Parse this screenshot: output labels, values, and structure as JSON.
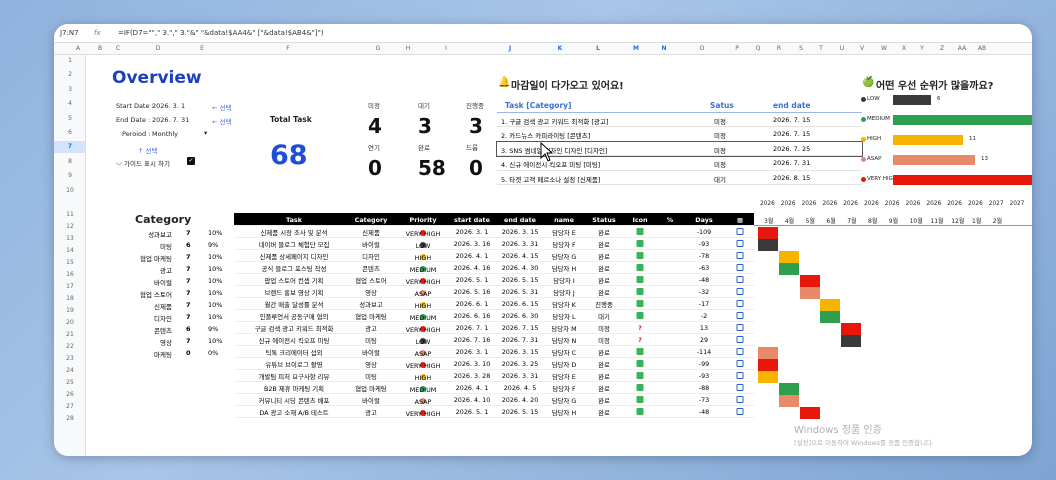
{
  "formula_bar": {
    "cell": "J7:N7",
    "fx": "fx",
    "formula": "=IF(D7=\"\",\"  3.\",\"  3.\"&\" \"&data!$AA4&\"  [\"&data!$AB4&\"]\")"
  },
  "columns": [
    "A",
    "B",
    "C",
    "D",
    "E",
    "F",
    "G",
    "H",
    "I",
    "J",
    "K",
    "L",
    "M",
    "N",
    "O",
    "P",
    "Q",
    "R",
    "S",
    "T",
    "U",
    "V",
    "W",
    "X",
    "Y",
    "Z",
    "AA",
    "AB"
  ],
  "rows": [
    "1",
    "2",
    "3",
    "4",
    "5",
    "6",
    "7",
    "8",
    "9",
    "10",
    "11",
    "12",
    "13",
    "14",
    "15",
    "16",
    "17",
    "18",
    "19",
    "20",
    "21",
    "22",
    "23",
    "24",
    "25",
    "26",
    "27",
    "28"
  ],
  "overview": {
    "title": "Overview",
    "start_label": "Start Date :",
    "start_value": "2026. 3. 1",
    "end_label": "End Date :",
    "end_value": "2026. 7. 31",
    "period_label": "Peroiod :",
    "period_value": "Monthly",
    "select_hint": "← 선택",
    "select_hint2": "← 선택",
    "select_hint3": "↑ 선택",
    "guide_label": "가이드 표시 하기",
    "total_label": "Total Task",
    "total_value": "68"
  },
  "stats": [
    {
      "label": "미정",
      "value": "4"
    },
    {
      "label": "대기",
      "value": "3"
    },
    {
      "label": "진행중",
      "value": "3"
    },
    {
      "label": "연기",
      "value": "0"
    },
    {
      "label": "완료",
      "value": "58"
    },
    {
      "label": "드롭",
      "value": "0"
    }
  ],
  "deadline": {
    "title": "마감일이 다가오고 있어요!",
    "headers": {
      "task": "Task [Category]",
      "status": "Satus",
      "end": "end date"
    },
    "rows": [
      {
        "task": "1. 구글 검색 광고 키워드 최적화 [광고]",
        "status": "미정",
        "end": "2026. 7. 15"
      },
      {
        "task": "2. 카드뉴스 카피라이팅 [콘텐츠]",
        "status": "미정",
        "end": "2026. 7. 15"
      },
      {
        "task": "3. SNS 썸네일 디자인 디자인 [디자인]",
        "status": "미정",
        "end": "2026. 7. 25"
      },
      {
        "task": "4. 신규 에이전시 킥오프 미팅 [미팅]",
        "status": "미정",
        "end": "2026. 7. 31"
      },
      {
        "task": "5. 타겟 고객 페르소나 설정 [신제품]",
        "status": "대기",
        "end": "2026. 8. 15"
      }
    ]
  },
  "priority": {
    "title": "어떤 우선 순위가 많을까요?",
    "rows": [
      {
        "label": "LOW",
        "value": "6",
        "count": 6,
        "color": "#3a3a3a",
        "dot": "#3a3a3a"
      },
      {
        "label": "MEDIUM",
        "value": "",
        "count": 25,
        "color": "#2e9e4f",
        "dot": "#2e9e4f"
      },
      {
        "label": "HIGH",
        "value": "11",
        "count": 11,
        "color": "#f4b400",
        "dot": "#f4b400"
      },
      {
        "label": "ASAP",
        "value": "13",
        "count": 13,
        "color": "#e8896a",
        "dot": "#e8896a"
      },
      {
        "label": "VERY HIGH",
        "value": "",
        "count": 24,
        "color": "#e8170b",
        "dot": "#e8170b"
      }
    ]
  },
  "category": {
    "title": "Category",
    "rows": [
      {
        "name": "성과보고",
        "n": "7",
        "pct": "10%"
      },
      {
        "name": "미팅",
        "n": "6",
        "pct": "9%"
      },
      {
        "name": "협업 마케팅",
        "n": "7",
        "pct": "10%"
      },
      {
        "name": "광고",
        "n": "7",
        "pct": "10%"
      },
      {
        "name": "바이럴",
        "n": "7",
        "pct": "10%"
      },
      {
        "name": "협업 스토어",
        "n": "7",
        "pct": "10%"
      },
      {
        "name": "신제품",
        "n": "7",
        "pct": "10%"
      },
      {
        "name": "디자인",
        "n": "7",
        "pct": "10%"
      },
      {
        "name": "콘텐츠",
        "n": "6",
        "pct": "9%"
      },
      {
        "name": "영상",
        "n": "7",
        "pct": "10%"
      },
      {
        "name": "마케팅",
        "n": "0",
        "pct": "0%"
      }
    ]
  },
  "tasks": {
    "headers": [
      "Task",
      "Category",
      "Priority",
      "start date",
      "end date",
      "name",
      "Status",
      "Icon",
      "%",
      "Days"
    ],
    "rows": [
      {
        "task": "신제품 시장 조사 및 분석",
        "cat": "신제품",
        "pri": "VERY HIGH",
        "pc": "#e8170b",
        "start": "2026. 3. 1",
        "end": "2026. 3. 15",
        "name": "담당자 E",
        "status": "완료",
        "icon": "done",
        "days": "-109"
      },
      {
        "task": "네이버 블로그 체험단 모집",
        "cat": "바이럴",
        "pri": "LOW",
        "pc": "#3a3a3a",
        "start": "2026. 3. 16",
        "end": "2026. 3. 31",
        "name": "담당자 F",
        "status": "완료",
        "icon": "done",
        "days": "-93"
      },
      {
        "task": "신제품 상세페이지 디자인",
        "cat": "디자인",
        "pri": "HIGH",
        "pc": "#f4b400",
        "start": "2026. 4. 1",
        "end": "2026. 4. 15",
        "name": "담당자 G",
        "status": "완료",
        "icon": "done",
        "days": "-78"
      },
      {
        "task": "공식 블로그 포스팅 작성",
        "cat": "콘텐츠",
        "pri": "MEDIUM",
        "pc": "#2e9e4f",
        "start": "2026. 4. 16",
        "end": "2026. 4. 30",
        "name": "담당자 H",
        "status": "완료",
        "icon": "done",
        "days": "-63"
      },
      {
        "task": "팝업 스토어 컨셉 기획",
        "cat": "협업 스토어",
        "pri": "VERY HIGH",
        "pc": "#e8170b",
        "start": "2026. 5. 1",
        "end": "2026. 5. 15",
        "name": "담당자 I",
        "status": "완료",
        "icon": "done",
        "days": "-48"
      },
      {
        "task": "브랜드 홍보 영상 기획",
        "cat": "영상",
        "pri": "ASAP",
        "pc": "#e8896a",
        "start": "2026. 5. 16",
        "end": "2026. 5. 31",
        "name": "담당자 J",
        "status": "완료",
        "icon": "done",
        "days": "-32"
      },
      {
        "task": "월간 매출 달성률 분석",
        "cat": "성과보고",
        "pri": "HIGH",
        "pc": "#f4b400",
        "start": "2026. 6. 1",
        "end": "2026. 6. 15",
        "name": "담당자 K",
        "status": "진행중",
        "icon": "done",
        "days": "-17"
      },
      {
        "task": "인플루언서 공동구매 협의",
        "cat": "협업 마케팅",
        "pri": "MEDIUM",
        "pc": "#2e9e4f",
        "start": "2026. 6. 16",
        "end": "2026. 6. 30",
        "name": "담당자 L",
        "status": "대기",
        "icon": "done",
        "days": "-2"
      },
      {
        "task": "구글 검색 광고 키워드 최적화",
        "cat": "광고",
        "pri": "VERY HIGH",
        "pc": "#e8170b",
        "start": "2026. 7. 1",
        "end": "2026. 7. 15",
        "name": "담당자 M",
        "status": "미정",
        "icon": "q",
        "days": "13"
      },
      {
        "task": "신규 에이전시 킥오프 미팅",
        "cat": "미팅",
        "pri": "LOW",
        "pc": "#3a3a3a",
        "start": "2026. 7. 16",
        "end": "2026. 7. 31",
        "name": "담당자 N",
        "status": "미정",
        "icon": "q",
        "days": "29"
      },
      {
        "task": "틱톡 크리에이터 섭외",
        "cat": "바이럴",
        "pri": "ASAP",
        "pc": "#e8896a",
        "start": "2026. 3. 1",
        "end": "2026. 3. 15",
        "name": "담당자 C",
        "status": "완료",
        "icon": "done",
        "days": "-114"
      },
      {
        "task": "유튜브 브이로그 촬영",
        "cat": "영상",
        "pri": "VERY HIGH",
        "pc": "#e8170b",
        "start": "2026. 3. 10",
        "end": "2026. 3. 25",
        "name": "담당자 D",
        "status": "완료",
        "icon": "done",
        "days": "-99"
      },
      {
        "task": "개발팀 피처 요구사항 리뷰",
        "cat": "미팅",
        "pri": "HIGH",
        "pc": "#f4b400",
        "start": "2026. 3. 28",
        "end": "2026. 3. 31",
        "name": "담당자 E",
        "status": "완료",
        "icon": "done",
        "days": "-93"
      },
      {
        "task": "B2B 제휴 마케팅 기획",
        "cat": "협업 마케팅",
        "pri": "MEDIUM",
        "pc": "#2e9e4f",
        "start": "2026. 4. 1",
        "end": "2026. 4. 5",
        "name": "담당자 F",
        "status": "완료",
        "icon": "done",
        "days": "-88"
      },
      {
        "task": "커뮤니티 시딩 콘텐츠 배포",
        "cat": "바이럴",
        "pri": "ASAP",
        "pc": "#e8896a",
        "start": "2026. 4. 10",
        "end": "2026. 4. 20",
        "name": "담당자 G",
        "status": "완료",
        "icon": "done",
        "days": "-73"
      },
      {
        "task": "DA 광고 소재 A/B 테스트",
        "cat": "광고",
        "pri": "VERY HIGH",
        "pc": "#e8170b",
        "start": "2026. 5. 1",
        "end": "2026. 5. 15",
        "name": "담당자 H",
        "status": "완료",
        "icon": "done",
        "days": "-48"
      }
    ]
  },
  "gantt": {
    "years": [
      "2026",
      "2026",
      "2026",
      "2026",
      "2026",
      "2026",
      "2026",
      "2026",
      "2026",
      "2026",
      "2026",
      "2027",
      "2027"
    ],
    "months": [
      "3월",
      "4월",
      "5월",
      "6월",
      "7월",
      "8월",
      "9월",
      "10월",
      "11월",
      "12월",
      "1월",
      "2월"
    ],
    "rows": [
      {
        "m": 0,
        "c": "#e8170b"
      },
      {
        "m": 0,
        "c": "#3a3a3a"
      },
      {
        "m": 1,
        "c": "#f4b400"
      },
      {
        "m": 1,
        "c": "#2e9e4f"
      },
      {
        "m": 2,
        "c": "#e8170b"
      },
      {
        "m": 2,
        "c": "#e8896a"
      },
      {
        "m": 3,
        "c": "#f4b400"
      },
      {
        "m": 3,
        "c": "#2e9e4f"
      },
      {
        "m": 4,
        "c": "#e8170b"
      },
      {
        "m": 4,
        "c": "#3a3a3a"
      },
      {
        "m": 0,
        "c": "#e8896a"
      },
      {
        "m": 0,
        "c": "#e8170b"
      },
      {
        "m": 0,
        "c": "#f4b400"
      },
      {
        "m": 1,
        "c": "#2e9e4f"
      },
      {
        "m": 1,
        "c": "#e8896a"
      },
      {
        "m": 2,
        "c": "#e8170b"
      }
    ]
  },
  "watermark": {
    "line1": "Windows 정품 인증",
    "line2": "[설정]으로 이동하여 Windows를 정품 인증합니다."
  }
}
